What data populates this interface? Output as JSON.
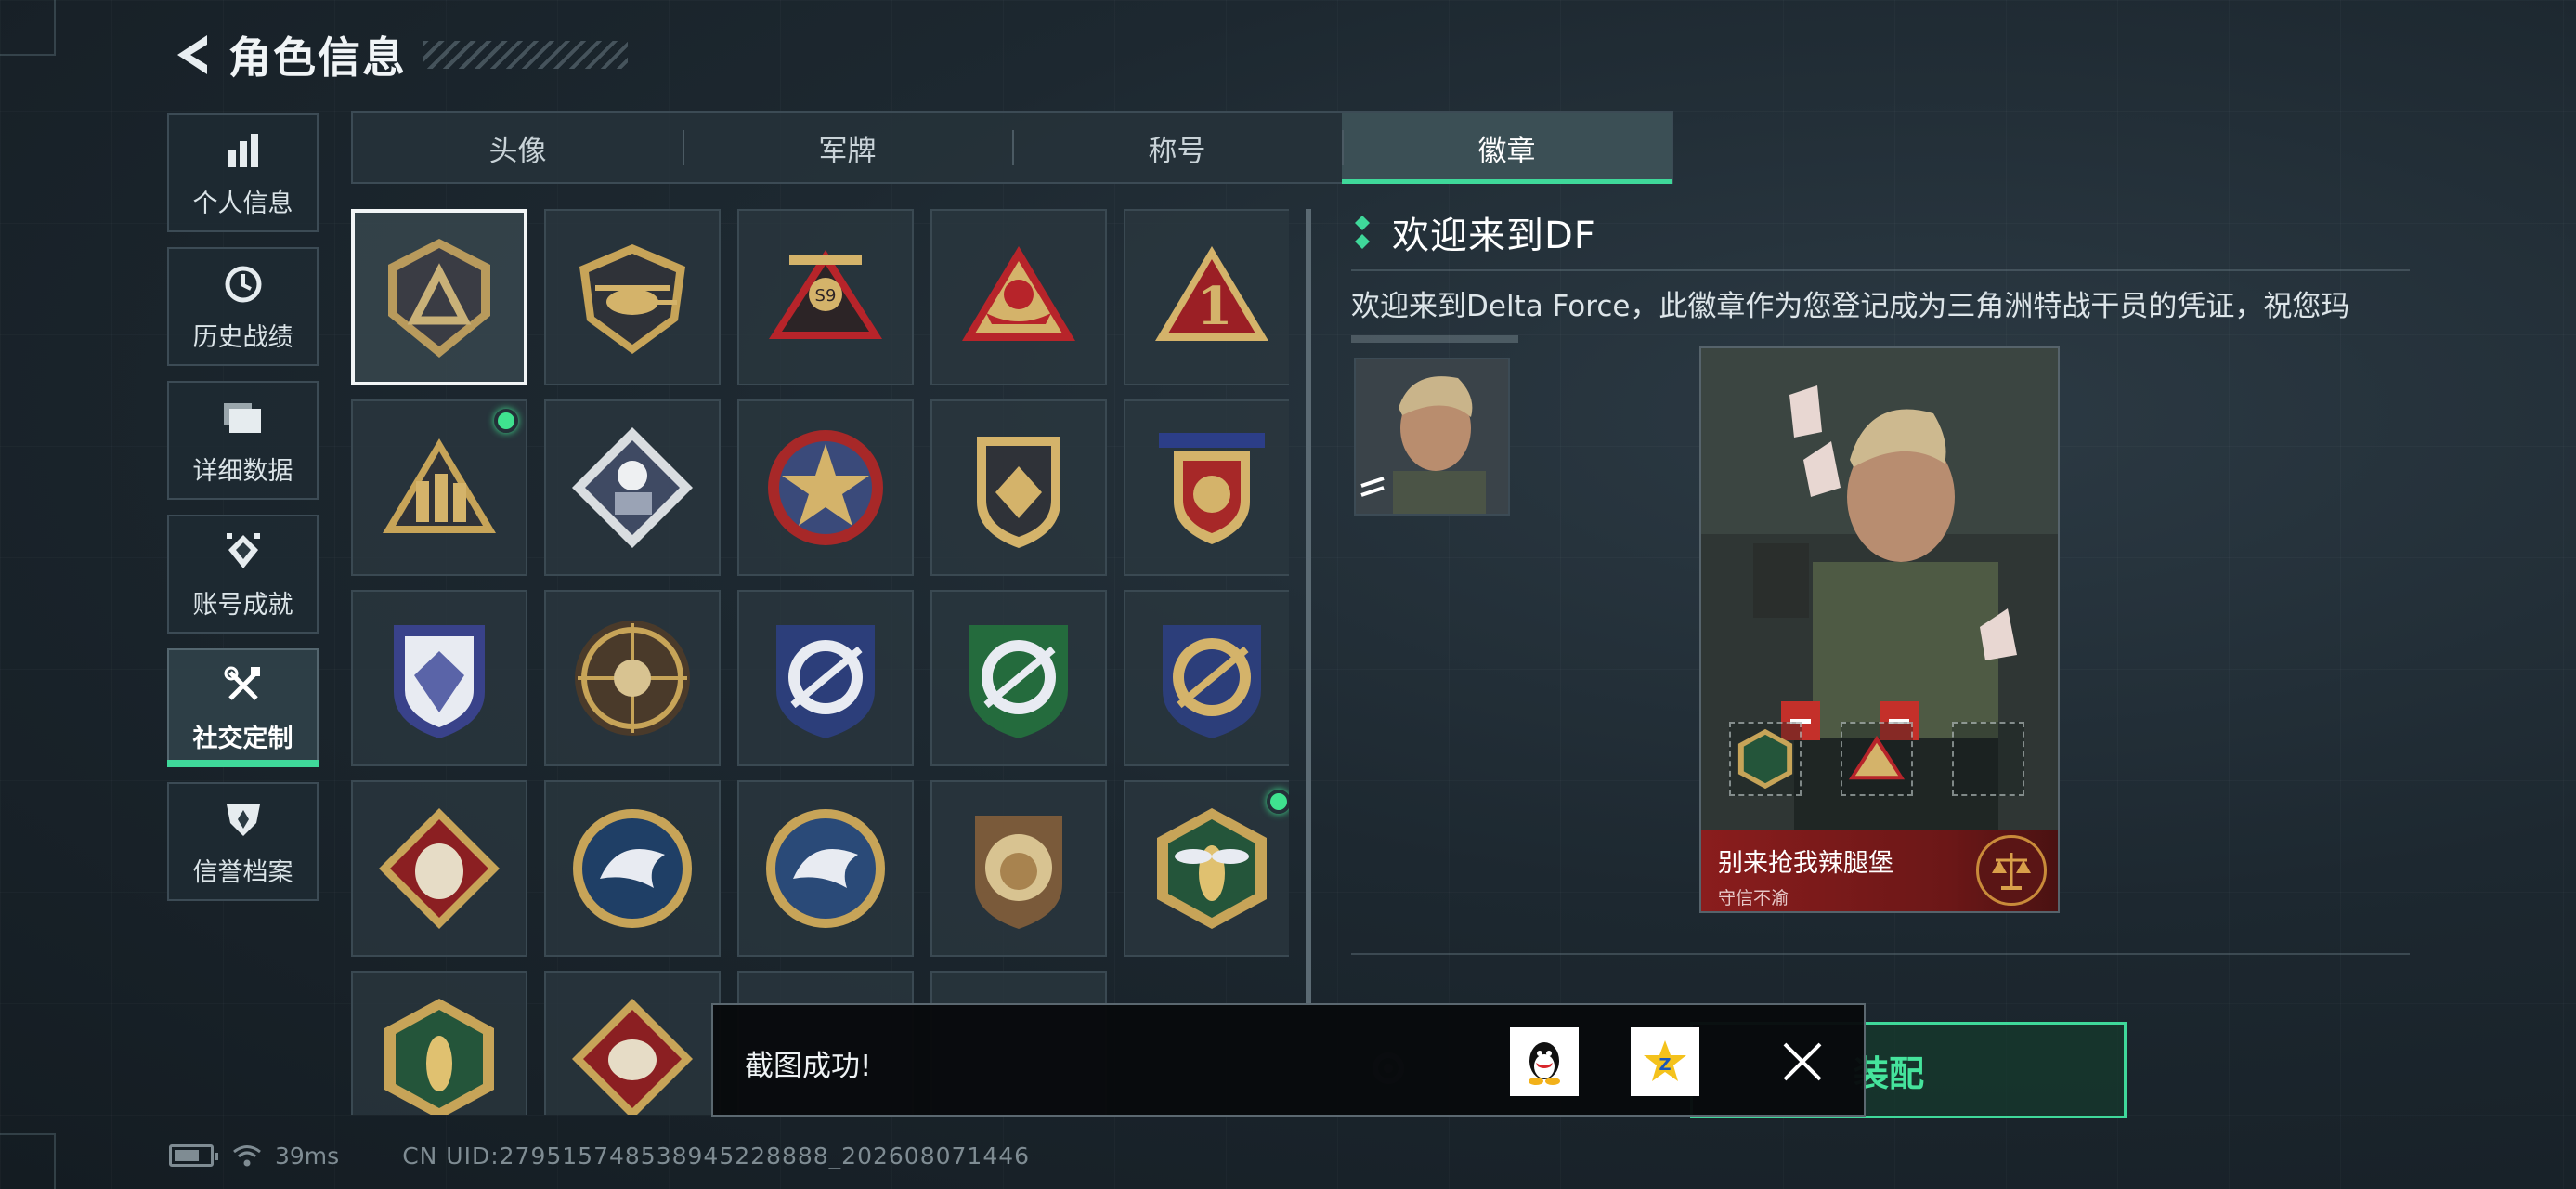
{
  "header": {
    "title": "角色信息"
  },
  "sidebar": {
    "items": [
      {
        "label": "个人信息",
        "icon": "bar-chart-icon",
        "active": false
      },
      {
        "label": "历史战绩",
        "icon": "history-clock-icon",
        "active": false
      },
      {
        "label": "详细数据",
        "icon": "folder-icon",
        "active": false
      },
      {
        "label": "账号成就",
        "icon": "achievement-icon",
        "active": false
      },
      {
        "label": "社交定制",
        "icon": "tools-icon",
        "active": true
      },
      {
        "label": "信誉档案",
        "icon": "credit-shield-icon",
        "active": false
      }
    ]
  },
  "tabs": [
    {
      "label": "头像",
      "active": false
    },
    {
      "label": "军牌",
      "active": false
    },
    {
      "label": "称号",
      "active": false
    },
    {
      "label": "徽章",
      "active": true
    }
  ],
  "badges": [
    {
      "name": "delta-shield-badge",
      "selected": true,
      "new": false
    },
    {
      "name": "helicopter-badge",
      "selected": false,
      "new": false
    },
    {
      "name": "s9-wings-badge",
      "selected": false,
      "new": false
    },
    {
      "name": "ship-triangle-badge",
      "selected": false,
      "new": false
    },
    {
      "name": "number-one-badge",
      "selected": false,
      "new": false
    },
    {
      "name": "soldiers-triangle-badge",
      "selected": false,
      "new": true
    },
    {
      "name": "rose-diamond-badge",
      "selected": false,
      "new": false
    },
    {
      "name": "star-emblem-badge",
      "selected": false,
      "new": false
    },
    {
      "name": "chevron-shield-badge",
      "selected": false,
      "new": false
    },
    {
      "name": "eagle-crest-badge",
      "selected": false,
      "new": false
    },
    {
      "name": "diamond-crest-badge",
      "selected": false,
      "new": false
    },
    {
      "name": "skull-crosshair-badge",
      "selected": false,
      "new": false
    },
    {
      "name": "rifle-blue-shield-badge",
      "selected": false,
      "new": false
    },
    {
      "name": "rifle-green-shield-badge",
      "selected": false,
      "new": false
    },
    {
      "name": "rifle-gold-shield-badge",
      "selected": false,
      "new": false
    },
    {
      "name": "wolf-diamond-badge",
      "selected": false,
      "new": false
    },
    {
      "name": "eagle-circle-badge",
      "selected": false,
      "new": false
    },
    {
      "name": "eagle-blue-circle-badge",
      "selected": false,
      "new": false
    },
    {
      "name": "lion-badge",
      "selected": false,
      "new": false
    },
    {
      "name": "hornet-hexagon-badge",
      "selected": false,
      "new": true
    },
    {
      "name": "hornet-green-badge",
      "selected": false,
      "new": false
    },
    {
      "name": "dragon-diamond-badge",
      "selected": false,
      "new": false
    },
    {
      "name": "hidden-badge-a",
      "selected": false,
      "new": false
    },
    {
      "name": "hidden-badge-b",
      "selected": false,
      "new": false
    }
  ],
  "detail": {
    "title": "欢迎来到DF",
    "description": "欢迎来到Delta Force，此徽章作为您登记成为三角洲特战干员的凭证，祝您玛",
    "card": {
      "name": "别来抢我辣腿堡",
      "subtitle": "守信不渝"
    },
    "equip_label": "装配"
  },
  "toast": {
    "message": "截图成功!"
  },
  "status": {
    "ping": "39ms",
    "uid": "CN UID:279515748538945228888_202608071446"
  },
  "colors": {
    "accent": "#3fd89a",
    "new_dot": "#3fe28f",
    "card_red": "#8a1d1d"
  }
}
